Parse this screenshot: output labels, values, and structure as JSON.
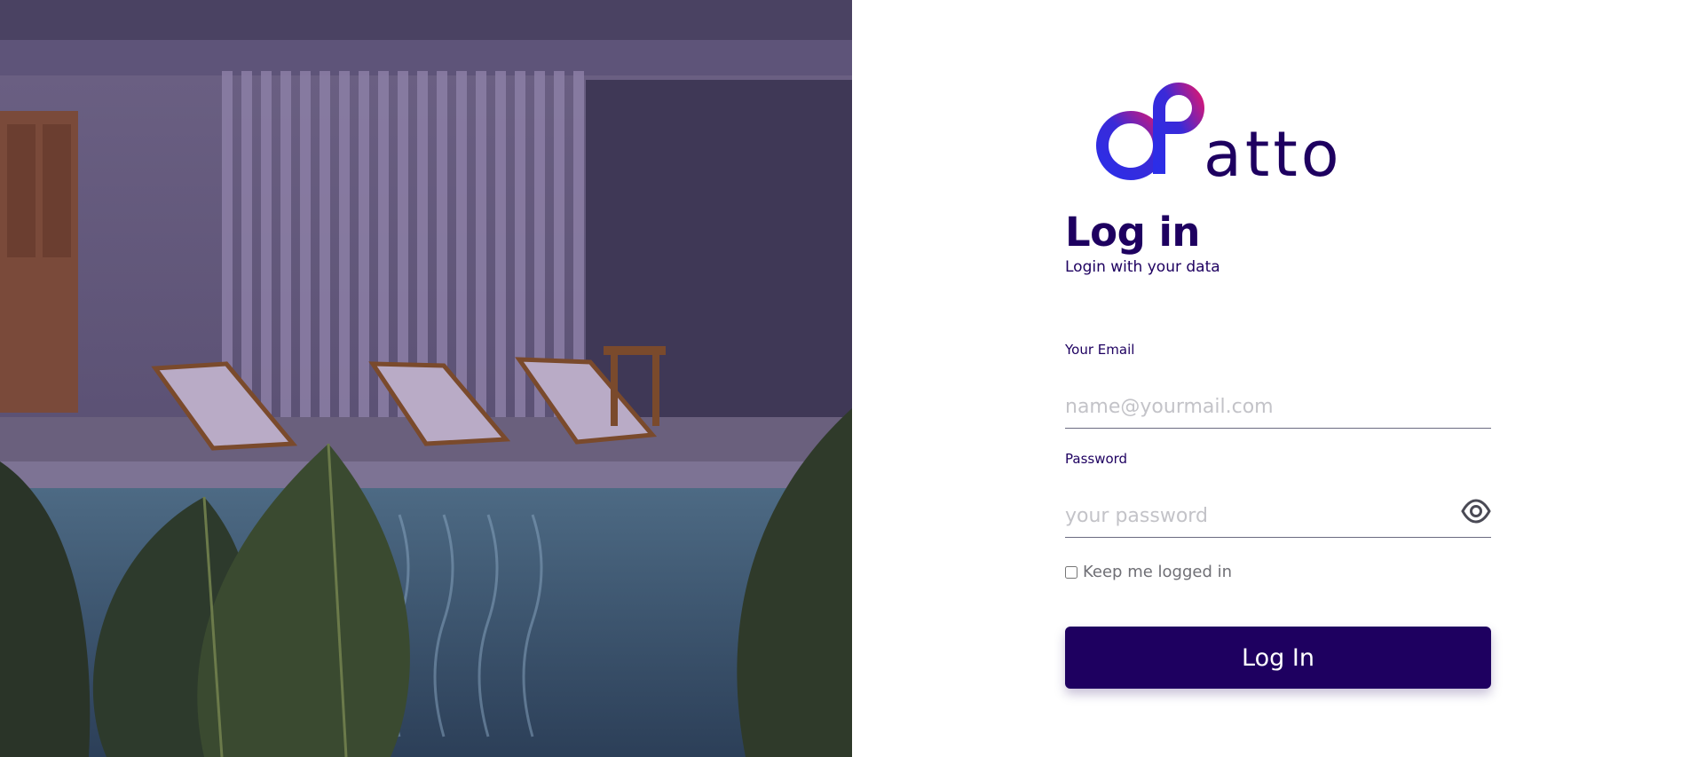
{
  "brand": {
    "name": "atto",
    "colors": {
      "primary": "#1e0060",
      "gradient_start": "#2b2ee8",
      "gradient_end": "#d0187a"
    }
  },
  "page": {
    "title": "Log in",
    "subtitle": "Login with your data"
  },
  "form": {
    "email": {
      "label": "Your Email",
      "placeholder": "name@yourmail.com",
      "value": ""
    },
    "password": {
      "label": "Password",
      "placeholder": "your password",
      "value": "",
      "toggle_icon": "eye-icon"
    },
    "remember": {
      "label": "Keep me logged in",
      "checked": false
    },
    "submit_label": "Log In"
  }
}
